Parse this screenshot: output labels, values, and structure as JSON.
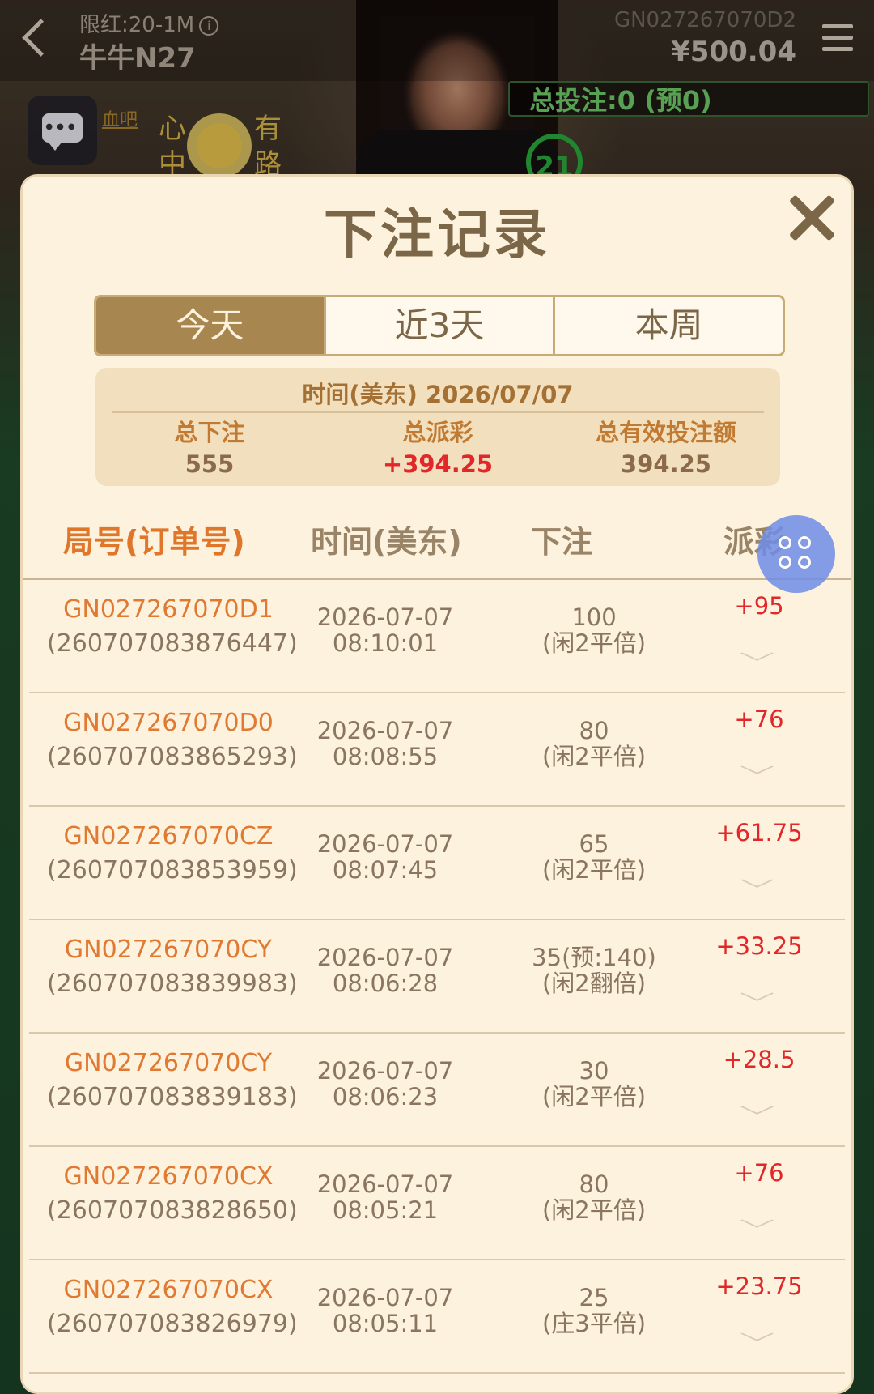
{
  "game": {
    "limit_label": "限红:20-1M",
    "table_name": "牛牛N27",
    "round_id": "GN027267070D2",
    "balance": "¥500.04",
    "total_bet": "总投注:0 (预0)",
    "banner_link": "血吧",
    "countdown": "21"
  },
  "modal": {
    "title": "下注记录",
    "tabs": [
      {
        "label": "今天",
        "active": true
      },
      {
        "label": "近3天",
        "active": false
      },
      {
        "label": "本周",
        "active": false
      }
    ],
    "summary": {
      "date": "时间(美东) 2026/07/07",
      "total_bet_label": "总下注",
      "total_bet_value": "555",
      "total_payout_label": "总派彩",
      "total_payout_value": "+394.25",
      "valid_bet_label": "总有效投注额",
      "valid_bet_value": "394.25"
    },
    "columns": {
      "order": "局号(订单号)",
      "time": "时间(美东)",
      "bet": "下注",
      "payout": "派彩"
    },
    "rows": [
      {
        "round": "GN027267070D1",
        "order": "(260707083876447)",
        "date": "2026-07-07",
        "time": "08:10:01",
        "amount": "100",
        "type": "(闲2平倍)",
        "payout": "+95"
      },
      {
        "round": "GN027267070D0",
        "order": "(260707083865293)",
        "date": "2026-07-07",
        "time": "08:08:55",
        "amount": "80",
        "type": "(闲2平倍)",
        "payout": "+76"
      },
      {
        "round": "GN027267070CZ",
        "order": "(260707083853959)",
        "date": "2026-07-07",
        "time": "08:07:45",
        "amount": "65",
        "type": "(闲2平倍)",
        "payout": "+61.75"
      },
      {
        "round": "GN027267070CY",
        "order": "(260707083839983)",
        "date": "2026-07-07",
        "time": "08:06:28",
        "amount": "35(预:140)",
        "type": "(闲2翻倍)",
        "payout": "+33.25"
      },
      {
        "round": "GN027267070CY",
        "order": "(260707083839183)",
        "date": "2026-07-07",
        "time": "08:06:23",
        "amount": "30",
        "type": "(闲2平倍)",
        "payout": "+28.5"
      },
      {
        "round": "GN027267070CX",
        "order": "(260707083828650)",
        "date": "2026-07-07",
        "time": "08:05:21",
        "amount": "80",
        "type": "(闲2平倍)",
        "payout": "+76"
      },
      {
        "round": "GN027267070CX",
        "order": "(260707083826979)",
        "date": "2026-07-07",
        "time": "08:05:11",
        "amount": "25",
        "type": "(庄3平倍)",
        "payout": "+23.75"
      }
    ]
  },
  "colors": {
    "modal_bg": "#fdf2dd",
    "accent_brown": "#a88650",
    "order_orange": "#e07a32",
    "payout_red": "#e0282a",
    "timer_green": "#2aa83c"
  },
  "icons": [
    "back-icon",
    "info-icon",
    "menu-icon",
    "chat-icon",
    "close-icon",
    "chevron-down-icon",
    "grid-icon"
  ]
}
